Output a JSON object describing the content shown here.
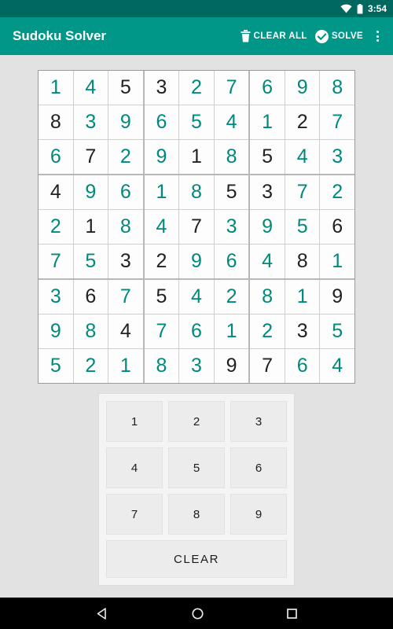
{
  "status_bar": {
    "time": "3:54",
    "icons": [
      "wifi-icon",
      "battery-icon"
    ]
  },
  "app_bar": {
    "title": "Sudoku Solver",
    "actions": [
      {
        "id": "clear-all",
        "label": "CLEAR ALL",
        "icon": "trash-icon"
      },
      {
        "id": "solve",
        "label": "SOLVE",
        "icon": "check-circle-icon"
      }
    ],
    "overflow_icon": "more-vert-icon",
    "background": "#009688"
  },
  "colors": {
    "accent": "#009688",
    "status_bar": "#00695f",
    "solved_digit": "#00897b",
    "given_digit": "#212121",
    "page_background": "#e2e2e2",
    "cell_background": "#fdfdfd",
    "numpad_panel": "#f4f4f4",
    "numpad_button": "#ececec"
  },
  "board": {
    "rows": [
      [
        {
          "value": "1",
          "state": "solved"
        },
        {
          "value": "4",
          "state": "solved"
        },
        {
          "value": "5",
          "state": "given"
        },
        {
          "value": "3",
          "state": "given"
        },
        {
          "value": "2",
          "state": "solved"
        },
        {
          "value": "7",
          "state": "solved"
        },
        {
          "value": "6",
          "state": "solved"
        },
        {
          "value": "9",
          "state": "solved"
        },
        {
          "value": "8",
          "state": "solved"
        }
      ],
      [
        {
          "value": "8",
          "state": "given"
        },
        {
          "value": "3",
          "state": "solved"
        },
        {
          "value": "9",
          "state": "solved"
        },
        {
          "value": "6",
          "state": "solved"
        },
        {
          "value": "5",
          "state": "solved"
        },
        {
          "value": "4",
          "state": "solved"
        },
        {
          "value": "1",
          "state": "solved"
        },
        {
          "value": "2",
          "state": "given"
        },
        {
          "value": "7",
          "state": "solved"
        }
      ],
      [
        {
          "value": "6",
          "state": "solved"
        },
        {
          "value": "7",
          "state": "given"
        },
        {
          "value": "2",
          "state": "solved"
        },
        {
          "value": "9",
          "state": "solved"
        },
        {
          "value": "1",
          "state": "given"
        },
        {
          "value": "8",
          "state": "solved"
        },
        {
          "value": "5",
          "state": "given"
        },
        {
          "value": "4",
          "state": "solved"
        },
        {
          "value": "3",
          "state": "solved"
        }
      ],
      [
        {
          "value": "4",
          "state": "given"
        },
        {
          "value": "9",
          "state": "solved"
        },
        {
          "value": "6",
          "state": "solved"
        },
        {
          "value": "1",
          "state": "solved"
        },
        {
          "value": "8",
          "state": "solved"
        },
        {
          "value": "5",
          "state": "given"
        },
        {
          "value": "3",
          "state": "given"
        },
        {
          "value": "7",
          "state": "solved"
        },
        {
          "value": "2",
          "state": "solved"
        }
      ],
      [
        {
          "value": "2",
          "state": "solved"
        },
        {
          "value": "1",
          "state": "given"
        },
        {
          "value": "8",
          "state": "solved"
        },
        {
          "value": "4",
          "state": "solved"
        },
        {
          "value": "7",
          "state": "given"
        },
        {
          "value": "3",
          "state": "solved"
        },
        {
          "value": "9",
          "state": "solved"
        },
        {
          "value": "5",
          "state": "solved"
        },
        {
          "value": "6",
          "state": "given"
        }
      ],
      [
        {
          "value": "7",
          "state": "solved"
        },
        {
          "value": "5",
          "state": "solved"
        },
        {
          "value": "3",
          "state": "given"
        },
        {
          "value": "2",
          "state": "given"
        },
        {
          "value": "9",
          "state": "solved"
        },
        {
          "value": "6",
          "state": "solved"
        },
        {
          "value": "4",
          "state": "solved"
        },
        {
          "value": "8",
          "state": "given"
        },
        {
          "value": "1",
          "state": "solved"
        }
      ],
      [
        {
          "value": "3",
          "state": "solved"
        },
        {
          "value": "6",
          "state": "given"
        },
        {
          "value": "7",
          "state": "solved"
        },
        {
          "value": "5",
          "state": "given"
        },
        {
          "value": "4",
          "state": "solved"
        },
        {
          "value": "2",
          "state": "solved"
        },
        {
          "value": "8",
          "state": "solved"
        },
        {
          "value": "1",
          "state": "solved"
        },
        {
          "value": "9",
          "state": "given"
        }
      ],
      [
        {
          "value": "9",
          "state": "solved"
        },
        {
          "value": "8",
          "state": "solved"
        },
        {
          "value": "4",
          "state": "given"
        },
        {
          "value": "7",
          "state": "solved"
        },
        {
          "value": "6",
          "state": "solved"
        },
        {
          "value": "1",
          "state": "solved"
        },
        {
          "value": "2",
          "state": "solved"
        },
        {
          "value": "3",
          "state": "given"
        },
        {
          "value": "5",
          "state": "solved"
        }
      ],
      [
        {
          "value": "5",
          "state": "solved"
        },
        {
          "value": "2",
          "state": "solved"
        },
        {
          "value": "1",
          "state": "solved"
        },
        {
          "value": "8",
          "state": "solved"
        },
        {
          "value": "3",
          "state": "solved"
        },
        {
          "value": "9",
          "state": "given"
        },
        {
          "value": "7",
          "state": "given"
        },
        {
          "value": "6",
          "state": "solved"
        },
        {
          "value": "4",
          "state": "solved"
        }
      ]
    ]
  },
  "numpad": {
    "rows": [
      [
        "1",
        "2",
        "3"
      ],
      [
        "4",
        "5",
        "6"
      ],
      [
        "7",
        "8",
        "9"
      ]
    ],
    "clear_label": "CLEAR"
  },
  "nav_bar": {
    "buttons": [
      {
        "id": "back",
        "icon": "back-triangle-icon"
      },
      {
        "id": "home",
        "icon": "home-circle-icon"
      },
      {
        "id": "recents",
        "icon": "recents-square-icon"
      }
    ]
  }
}
